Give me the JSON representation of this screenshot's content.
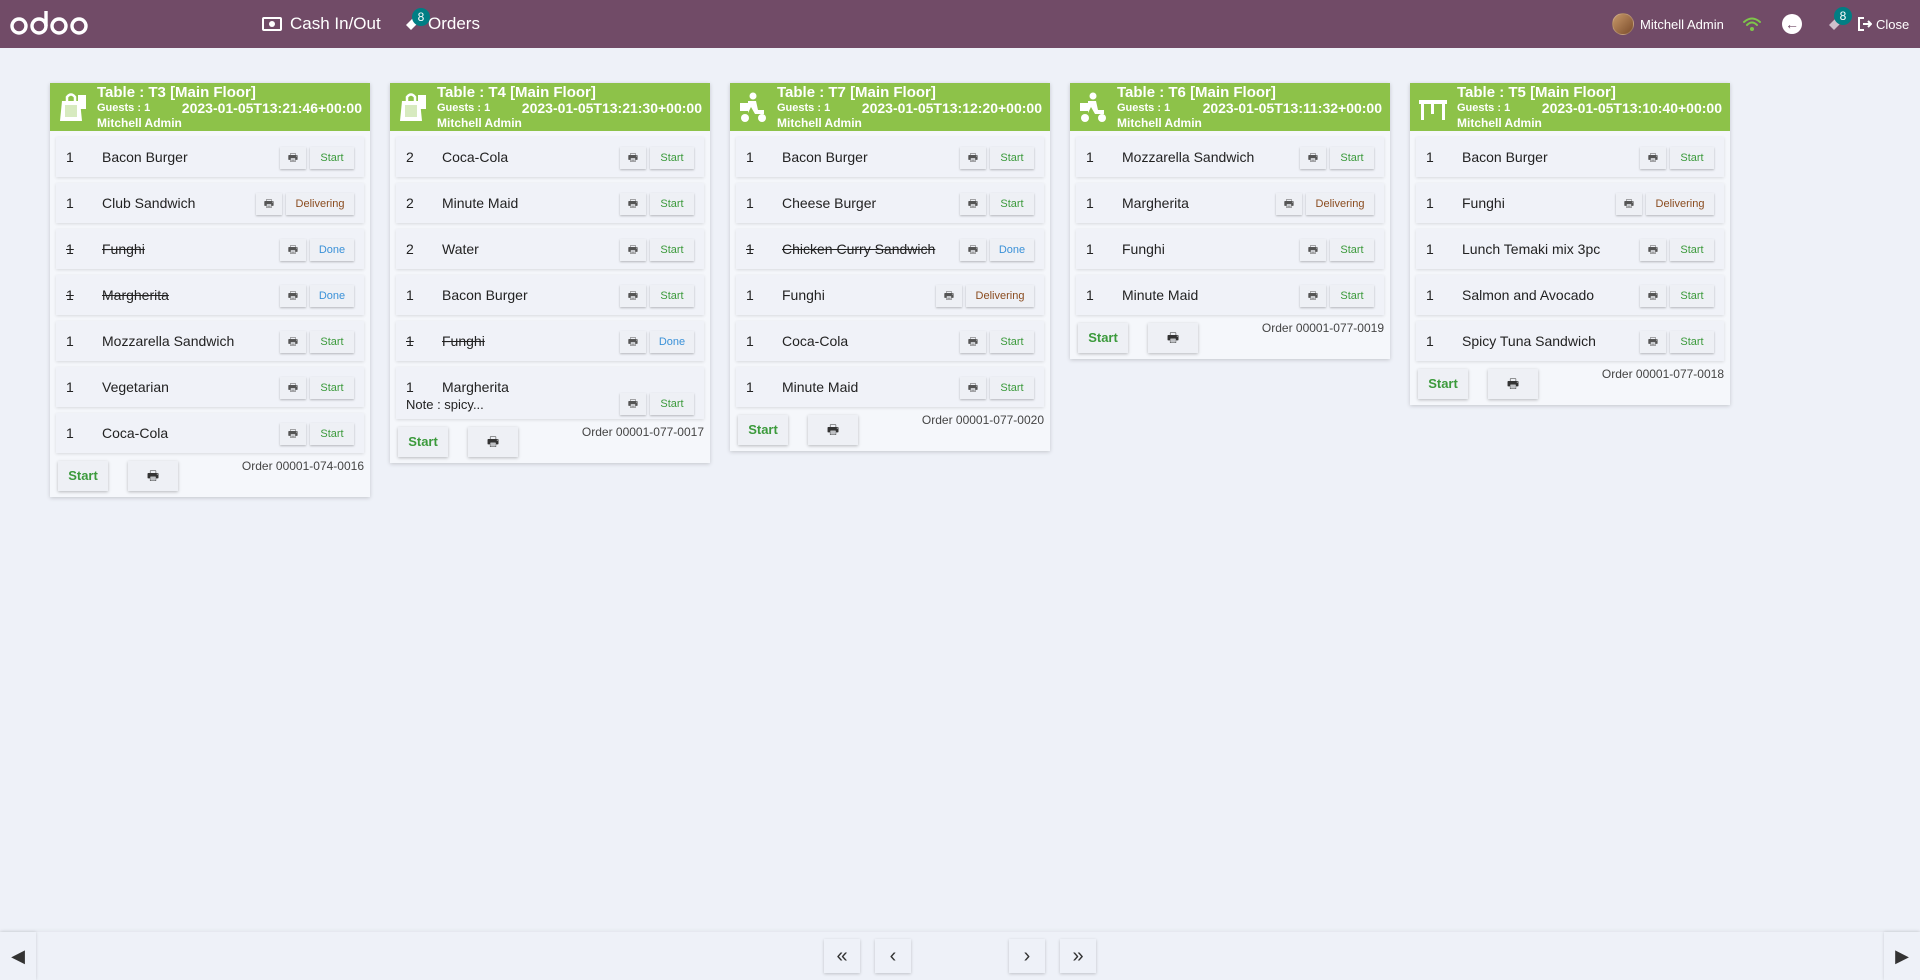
{
  "topbar": {
    "cash_label": "Cash In/Out",
    "orders_label": "Orders",
    "orders_badge": "8",
    "user_name": "Mitchell Admin",
    "right_orders_badge": "8",
    "close_label": "Close",
    "background_color": "#714b67",
    "accent_color": "#017e84"
  },
  "print_glyph": "🖶",
  "cards": [
    {
      "icon": "takeaway-bag-icon",
      "title": "Table : T3 [Main Floor]",
      "guests": "Guests : 1",
      "datetime": "2023-01-05T13:21:46+00:00",
      "waiter": "Mitchell Admin",
      "lines": [
        {
          "qty": "1",
          "name": "Bacon Burger",
          "status": "Start"
        },
        {
          "qty": "1",
          "name": "Club Sandwich",
          "status": "Delivering"
        },
        {
          "qty": "1",
          "name": "Funghi",
          "status": "Done"
        },
        {
          "qty": "1",
          "name": "Margherita",
          "status": "Done"
        },
        {
          "qty": "1",
          "name": "Mozzarella Sandwich",
          "status": "Start"
        },
        {
          "qty": "1",
          "name": "Vegetarian",
          "status": "Start"
        },
        {
          "qty": "1",
          "name": "Coca-Cola",
          "status": "Start"
        }
      ],
      "start_label": "Start",
      "order_ref": "Order 00001-074-0016"
    },
    {
      "icon": "takeaway-bag-icon",
      "title": "Table : T4 [Main Floor]",
      "guests": "Guests : 1",
      "datetime": "2023-01-05T13:21:30+00:00",
      "waiter": "Mitchell Admin",
      "lines": [
        {
          "qty": "2",
          "name": "Coca-Cola",
          "status": "Start"
        },
        {
          "qty": "2",
          "name": "Minute Maid",
          "status": "Start"
        },
        {
          "qty": "2",
          "name": "Water",
          "status": "Start"
        },
        {
          "qty": "1",
          "name": "Bacon Burger",
          "status": "Start"
        },
        {
          "qty": "1",
          "name": "Funghi",
          "status": "Done"
        },
        {
          "qty": "1",
          "name": "Margherita",
          "status": "Start",
          "note": "Note : spicy..."
        }
      ],
      "start_label": "Start",
      "order_ref": "Order 00001-077-0017"
    },
    {
      "icon": "delivery-scooter-icon",
      "title": "Table : T7 [Main Floor]",
      "guests": "Guests : 1",
      "datetime": "2023-01-05T13:12:20+00:00",
      "waiter": "Mitchell Admin",
      "lines": [
        {
          "qty": "1",
          "name": "Bacon Burger",
          "status": "Start"
        },
        {
          "qty": "1",
          "name": "Cheese Burger",
          "status": "Start"
        },
        {
          "qty": "1",
          "name": "Chicken Curry Sandwich",
          "status": "Done"
        },
        {
          "qty": "1",
          "name": "Funghi",
          "status": "Delivering"
        },
        {
          "qty": "1",
          "name": "Coca-Cola",
          "status": "Start"
        },
        {
          "qty": "1",
          "name": "Minute Maid",
          "status": "Start"
        }
      ],
      "start_label": "Start",
      "order_ref": "Order 00001-077-0020"
    },
    {
      "icon": "delivery-scooter-icon",
      "title": "Table : T6 [Main Floor]",
      "guests": "Guests : 1",
      "datetime": "2023-01-05T13:11:32+00:00",
      "waiter": "Mitchell Admin",
      "lines": [
        {
          "qty": "1",
          "name": "Mozzarella Sandwich",
          "status": "Start"
        },
        {
          "qty": "1",
          "name": "Margherita",
          "status": "Delivering"
        },
        {
          "qty": "1",
          "name": "Funghi",
          "status": "Start"
        },
        {
          "qty": "1",
          "name": "Minute Maid",
          "status": "Start"
        }
      ],
      "start_label": "Start",
      "order_ref": "Order 00001-077-0019"
    },
    {
      "icon": "dine-in-table-icon",
      "title": "Table : T5 [Main Floor]",
      "guests": "Guests : 1",
      "datetime": "2023-01-05T13:10:40+00:00",
      "waiter": "Mitchell Admin",
      "lines": [
        {
          "qty": "1",
          "name": "Bacon Burger",
          "status": "Start"
        },
        {
          "qty": "1",
          "name": "Funghi",
          "status": "Delivering"
        },
        {
          "qty": "1",
          "name": "Lunch Temaki mix 3pc",
          "status": "Start"
        },
        {
          "qty": "1",
          "name": "Salmon and Avocado",
          "status": "Start"
        },
        {
          "qty": "1",
          "name": "Spicy Tuna Sandwich",
          "status": "Start"
        }
      ],
      "start_label": "Start",
      "order_ref": "Order 00001-077-0018"
    }
  ],
  "colors": {
    "card_header": "#8dc249",
    "status_start": "#3c9a3c",
    "status_done": "#3a91d8",
    "status_delivering": "#8a4b1e"
  }
}
